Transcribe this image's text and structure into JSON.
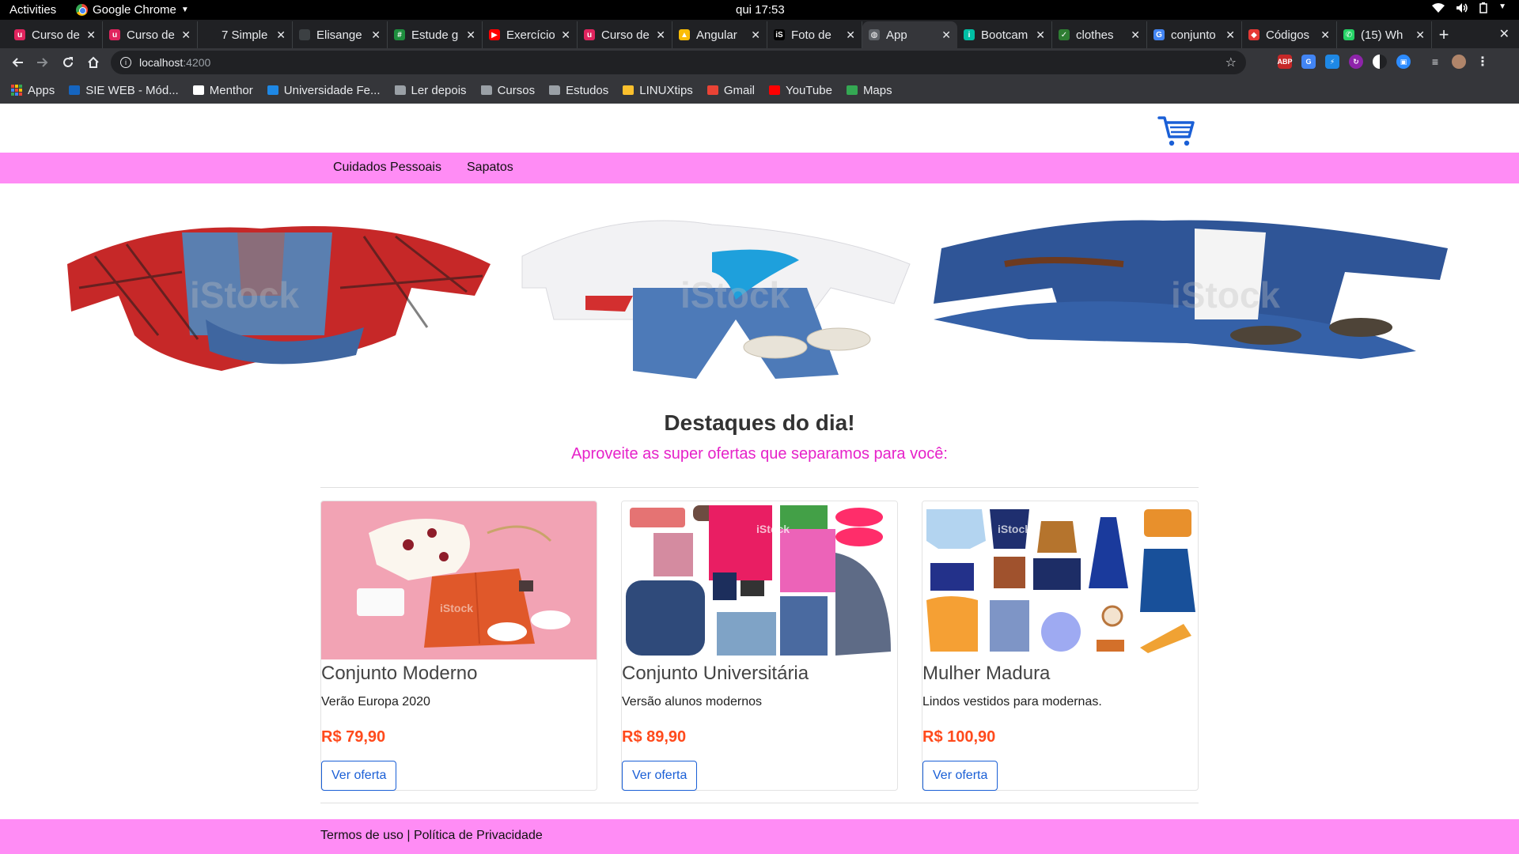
{
  "system": {
    "activities": "Activities",
    "app_name": "Google Chrome",
    "clock": "qui 17:53"
  },
  "tabs": [
    {
      "title": "Curso de",
      "color": "#e0245e",
      "glyph": "u"
    },
    {
      "title": "Curso de",
      "color": "#e0245e",
      "glyph": "u"
    },
    {
      "title": "7 Simple",
      "color": "#202124",
      "glyph": ""
    },
    {
      "title": "Elisange",
      "color": "#3c4043",
      "glyph": ""
    },
    {
      "title": "Estude g",
      "color": "#1e8e3e",
      "glyph": "#"
    },
    {
      "title": "Exercício",
      "color": "#ff0000",
      "glyph": "▶"
    },
    {
      "title": "Curso de",
      "color": "#e0245e",
      "glyph": "u"
    },
    {
      "title": "Angular",
      "color": "#fbbc05",
      "glyph": "▲"
    },
    {
      "title": "Foto de",
      "color": "#000000",
      "glyph": "iS"
    },
    {
      "title": "App",
      "color": "#5f6368",
      "glyph": "◍"
    },
    {
      "title": "Bootcam",
      "color": "#00bfa5",
      "glyph": "i"
    },
    {
      "title": "clothes",
      "color": "#2e7d32",
      "glyph": "✓"
    },
    {
      "title": "conjunto",
      "color": "#4285f4",
      "glyph": "G"
    },
    {
      "title": "Códigos",
      "color": "#e53935",
      "glyph": "◆"
    },
    {
      "title": "(15) Wh",
      "color": "#25d366",
      "glyph": "✆"
    }
  ],
  "active_tab_index": 9,
  "omnibox": {
    "host": "localhost",
    "port": ":4200"
  },
  "bookmarks": [
    {
      "label": "Apps",
      "kind": "apps"
    },
    {
      "label": "SIE WEB - Mód...",
      "kind": "site",
      "color": "#1565c0"
    },
    {
      "label": "Menthor",
      "kind": "site",
      "color": "#ffffff"
    },
    {
      "label": "Universidade Fe...",
      "kind": "site",
      "color": "#1e88e5"
    },
    {
      "label": "Ler depois",
      "kind": "folder"
    },
    {
      "label": "Cursos",
      "kind": "folder"
    },
    {
      "label": "Estudos",
      "kind": "folder"
    },
    {
      "label": "LINUXtips",
      "kind": "site",
      "color": "#fbc02d"
    },
    {
      "label": "Gmail",
      "kind": "site",
      "color": "#ea4335"
    },
    {
      "label": "YouTube",
      "kind": "site",
      "color": "#ff0000"
    },
    {
      "label": "Maps",
      "kind": "site",
      "color": "#34a853"
    }
  ],
  "store": {
    "nav": [
      "Cuidados Pessoais",
      "Sapatos"
    ],
    "headline": "Destaques do dia!",
    "subheadline": "Aproveite as super ofertas que separamos para você:",
    "accent_color": "#ff8cf5",
    "subheadline_color": "#e622c9",
    "price_color": "#ff4a1c",
    "watermark": "iStock",
    "products": [
      {
        "title": "Conjunto Moderno",
        "description": "Verão Europa 2020",
        "price": "R$ 79,90",
        "button": "Ver oferta"
      },
      {
        "title": "Conjunto Universitária",
        "description": "Versão alunos modernos",
        "price": "R$ 89,90",
        "button": "Ver oferta"
      },
      {
        "title": "Mulher Madura",
        "description": "Lindos vestidos para modernas.",
        "price": "R$ 100,90",
        "button": "Ver oferta"
      }
    ],
    "footer": "Termos de uso | Política de Privacidade"
  }
}
